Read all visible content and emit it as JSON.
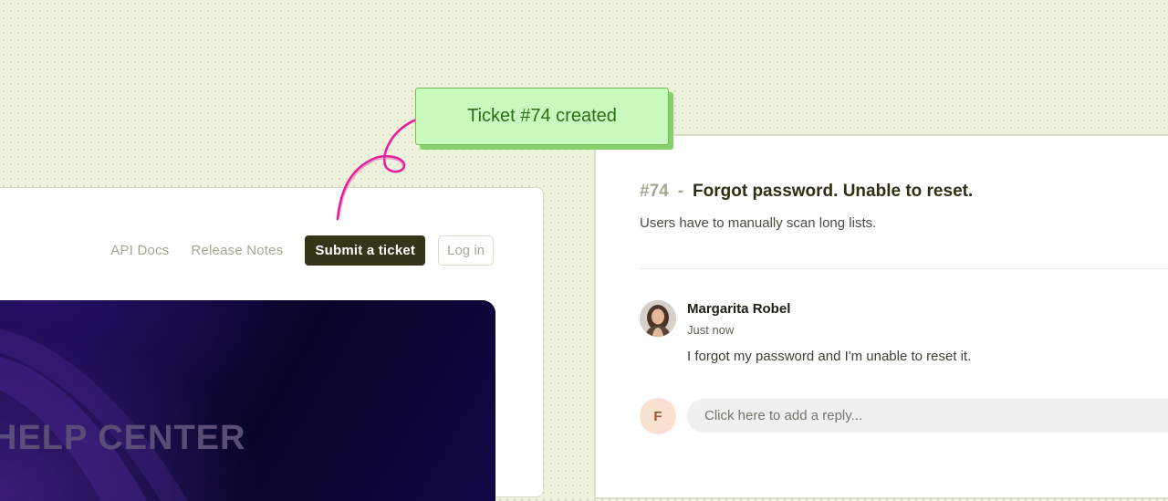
{
  "site": {
    "nav": {
      "api_docs": "API Docs",
      "release_notes": "Release Notes",
      "submit_ticket": "Submit a ticket",
      "log_in": "Log in"
    },
    "hero_title": "HELP CENTER"
  },
  "toast": {
    "message": "Ticket #74 created"
  },
  "ticket": {
    "number": "#74",
    "separator": "-",
    "title": "Forgot password. Unable to reset.",
    "description": "Users have to manually scan long lists.",
    "comments": [
      {
        "author": "Margarita Robel",
        "time": "Just now",
        "body": "I forgot my password and I'm unable to reset it."
      }
    ],
    "reply": {
      "avatar_initial": "F",
      "placeholder": "Click here to add a reply..."
    }
  },
  "colors": {
    "primary_button": "#35351a",
    "toast_background": "#c9fbbf",
    "toast_text": "#2b6d15",
    "annotation_stroke": "#e61e9c",
    "page_background": "#eef1dc"
  }
}
